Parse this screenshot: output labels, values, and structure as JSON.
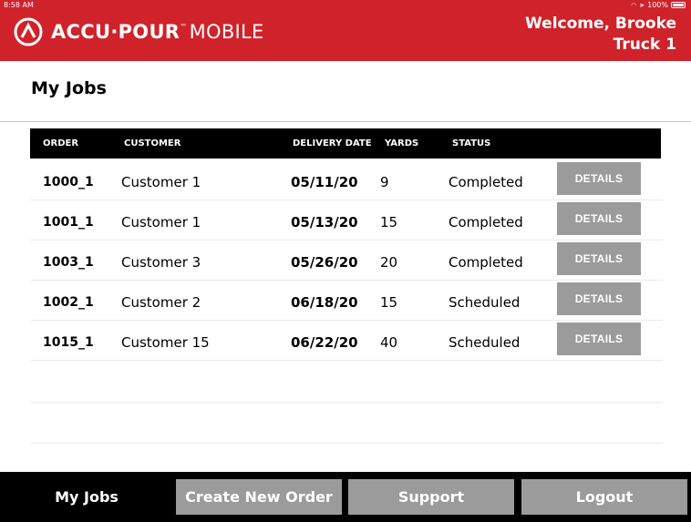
{
  "status_bar": {
    "time": "8:58 AM",
    "battery": "100%"
  },
  "header": {
    "logo_bold": "ACCU·POUR",
    "logo_tm": "™",
    "logo_light": "MOBILE",
    "welcome": "Welcome, Brooke",
    "truck": "Truck 1",
    "brand_color": "#d0222a"
  },
  "page": {
    "title": "My Jobs"
  },
  "table": {
    "headers": {
      "order": "ORDER",
      "customer": "CUSTOMER",
      "delivery_date": "DELIVERY DATE",
      "yards": "YARDS",
      "status": "STATUS"
    },
    "rows": [
      {
        "order": "1000_1",
        "customer": "Customer 1",
        "delivery_date": "05/11/20",
        "yards": "9",
        "status": "Completed",
        "action": "DETAILS"
      },
      {
        "order": "1001_1",
        "customer": "Customer 1",
        "delivery_date": "05/13/20",
        "yards": "15",
        "status": "Completed",
        "action": "DETAILS"
      },
      {
        "order": "1003_1",
        "customer": "Customer 3",
        "delivery_date": "05/26/20",
        "yards": "20",
        "status": "Completed",
        "action": "DETAILS"
      },
      {
        "order": "1002_1",
        "customer": "Customer 2",
        "delivery_date": "06/18/20",
        "yards": "15",
        "status": "Scheduled",
        "action": "DETAILS"
      },
      {
        "order": "1015_1",
        "customer": "Customer 15",
        "delivery_date": "06/22/20",
        "yards": "40",
        "status": "Scheduled",
        "action": "DETAILS"
      }
    ]
  },
  "bottom_nav": {
    "my_jobs": "My Jobs",
    "create_new_order": "Create New Order",
    "support": "Support",
    "logout": "Logout"
  }
}
